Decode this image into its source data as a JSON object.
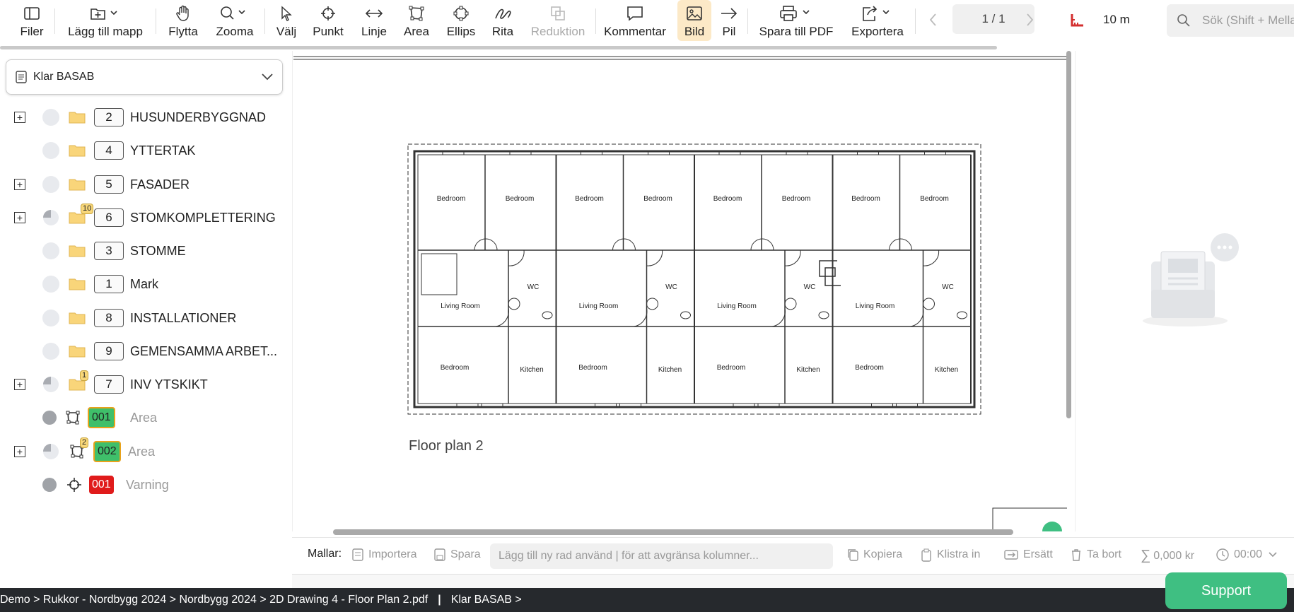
{
  "toolbar": {
    "buttons": [
      {
        "label": "Filer",
        "icon": "sidebar-panel-icon"
      },
      {
        "label": "Lägg till mapp",
        "icon": "folder-plus-icon"
      },
      {
        "label": "Flytta",
        "icon": "hand-icon"
      },
      {
        "label": "Zooma",
        "icon": "magnifier-icon"
      },
      {
        "label": "Välj",
        "icon": "pointer-icon"
      },
      {
        "label": "Punkt",
        "icon": "crosshair-icon"
      },
      {
        "label": "Linje",
        "icon": "double-arrow-icon"
      },
      {
        "label": "Area",
        "icon": "polygon-icon"
      },
      {
        "label": "Ellips",
        "icon": "ellipse-icon"
      },
      {
        "label": "Rita",
        "icon": "pen-icon"
      },
      {
        "label": "Reduktion",
        "icon": "reduction-icon"
      },
      {
        "label": "Kommentar",
        "icon": "comment-icon"
      },
      {
        "label": "Bild",
        "icon": "image-icon"
      },
      {
        "label": "Pil",
        "icon": "arrow-icon"
      },
      {
        "label": "Spara till PDF",
        "icon": "printer-icon"
      },
      {
        "label": "Exportera",
        "icon": "export-icon"
      }
    ],
    "page_indicator": "1 / 1",
    "scale": "10 m",
    "search_placeholder": "Sök (Shift + Mella"
  },
  "sidebar": {
    "project": "Klar BASAB",
    "items": [
      {
        "number": "2",
        "label": "HUSUNDERBYGGNAD"
      },
      {
        "number": "4",
        "label": "YTTERTAK"
      },
      {
        "number": "5",
        "label": "FASADER"
      },
      {
        "number": "6",
        "label": "STOMKOMPLETTERING",
        "badge": "10"
      },
      {
        "number": "3",
        "label": "STOMME"
      },
      {
        "number": "1",
        "label": "Mark"
      },
      {
        "number": "8",
        "label": "INSTALLATIONER"
      },
      {
        "number": "9",
        "label": "GEMENSAMMA ARBET..."
      },
      {
        "number": "7",
        "label": "INV YTSKIKT",
        "badge": "1"
      }
    ],
    "objects": [
      {
        "code": "001",
        "label": "Area",
        "color": "#3fbf6a"
      },
      {
        "code": "002",
        "label": "Area",
        "color": "#3fbf6a",
        "badge": "2"
      },
      {
        "code": "001",
        "label": "Varning",
        "color": "#e01b1b"
      }
    ]
  },
  "drawing": {
    "caption": "Floor plan 2",
    "rooms": {
      "bedroom": "Bedroom",
      "living": "Living Room",
      "wc": "WC",
      "kitchen": "Kitchen"
    }
  },
  "bottombar": {
    "templates_label": "Mallar:",
    "import": "Importera",
    "save": "Spara",
    "row_placeholder": "Lägg till ny rad använd | för att avgränsa kolumner...",
    "copy": "Kopiera",
    "paste": "Klistra in",
    "replace": "Ersätt",
    "delete": "Ta bort",
    "sum": "0,000 kr",
    "time": "00:00"
  },
  "statusbar": {
    "breadcrumb": "Demo > Rukkor - Nordbygg 2024 > Nordbygg 2024 > 2D Drawing 4 - Floor Plan 2.pdf",
    "project": "Klar BASAB >"
  },
  "support_label": "Support",
  "colors": {
    "accent_active": "#fce9c7",
    "support": "#3fbf82",
    "statusbar": "#26292d"
  }
}
